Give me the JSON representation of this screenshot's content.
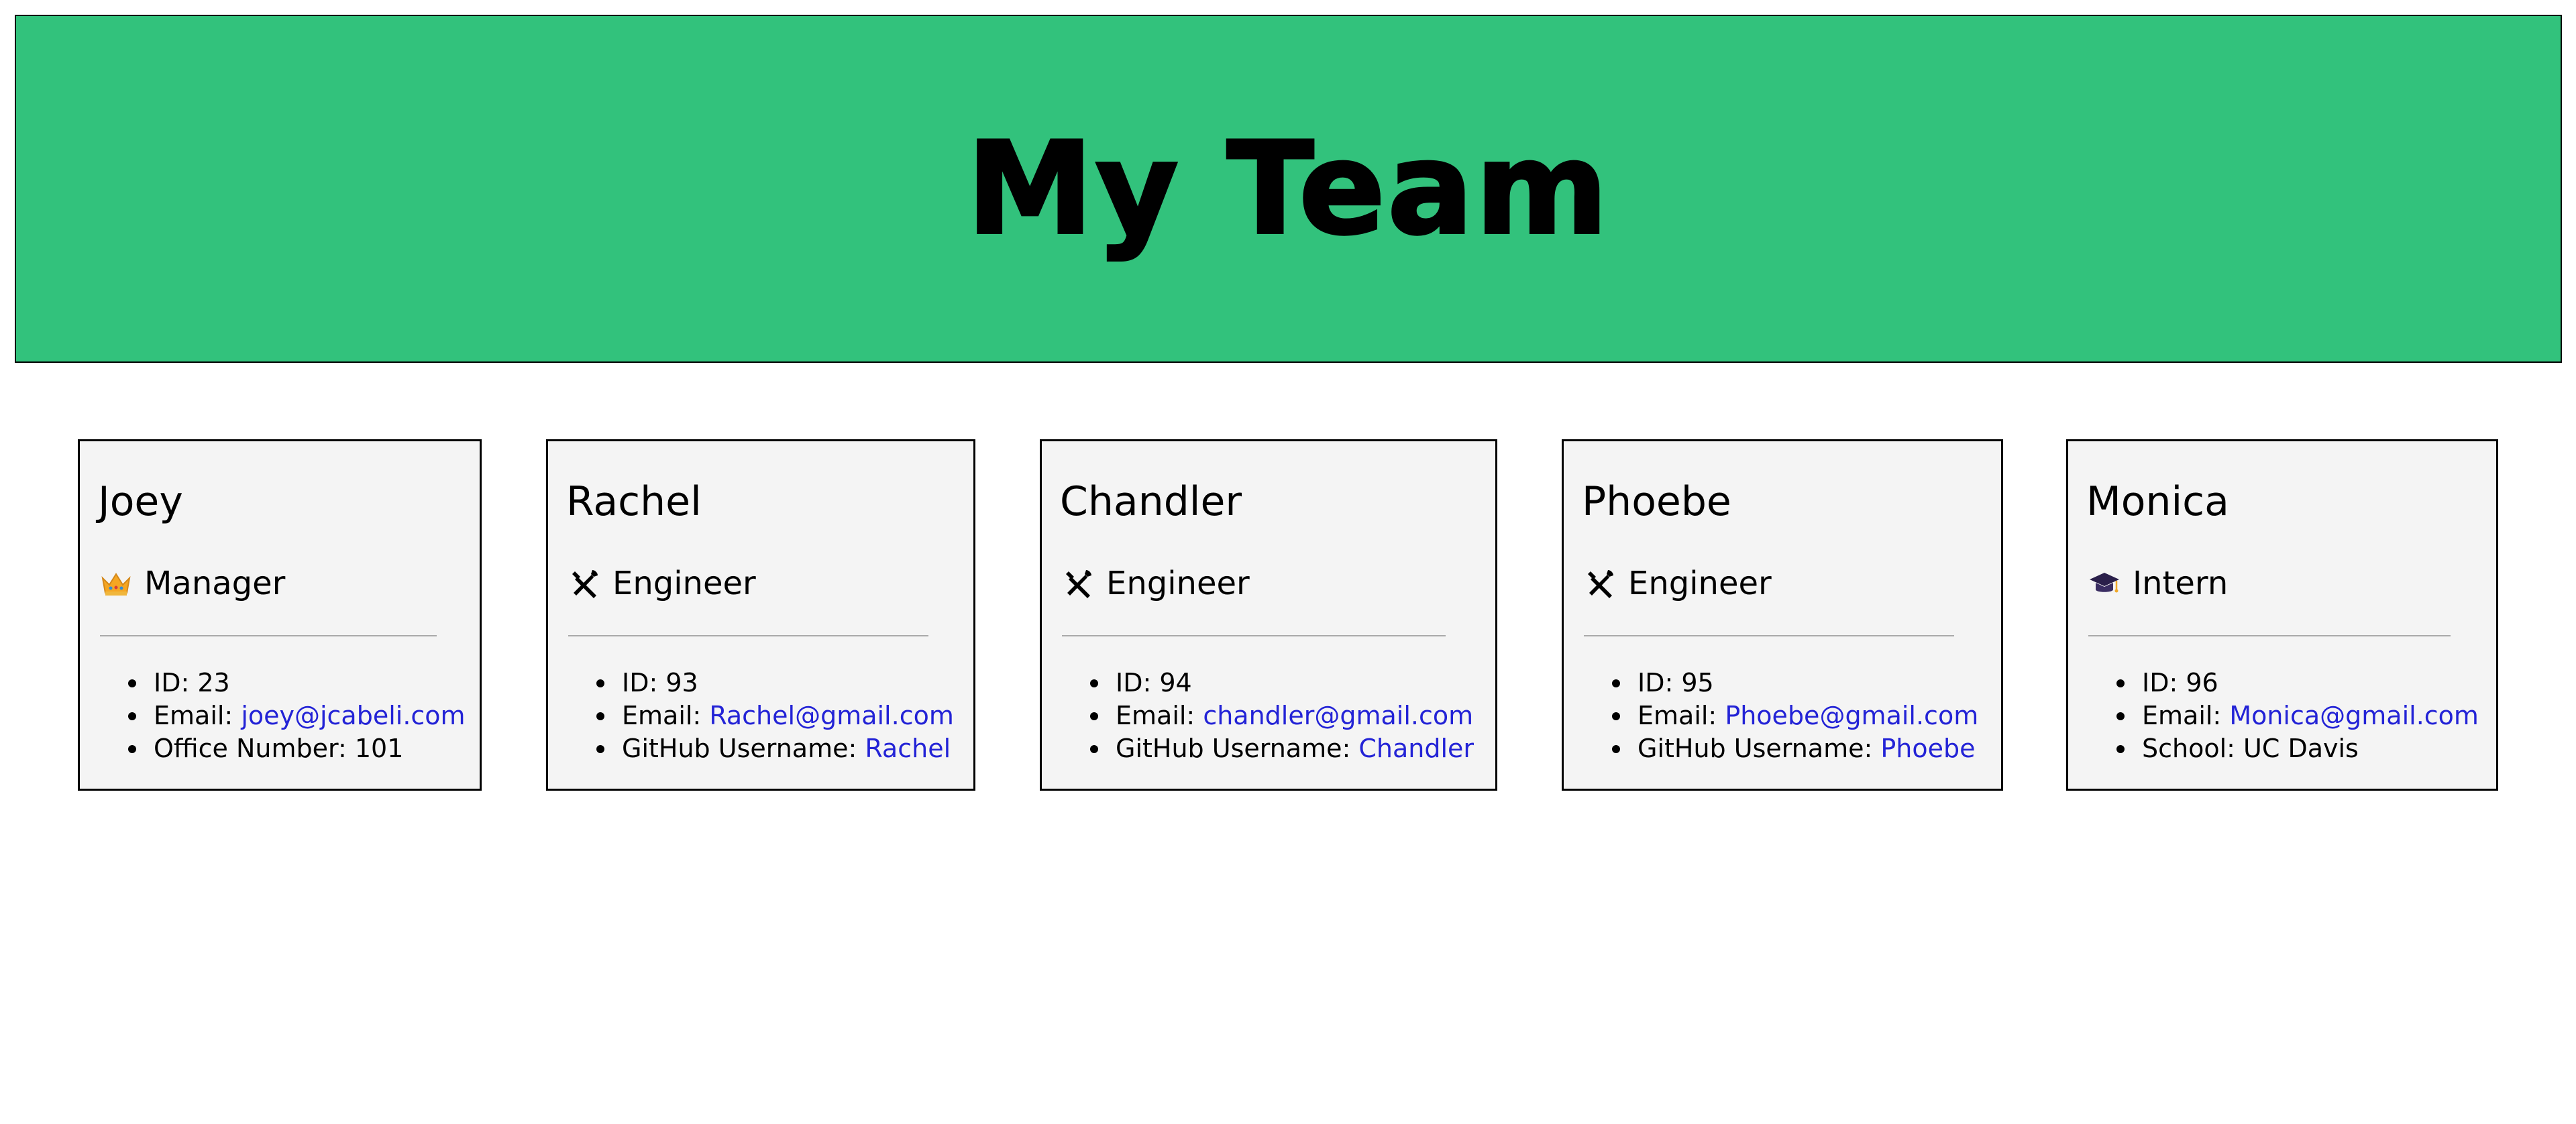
{
  "header": {
    "title": "My Team"
  },
  "colors": {
    "header_bg": "#32c27c",
    "card_bg": "#f4f4f4",
    "link": "#2323d6",
    "divider": "#a9a9a9"
  },
  "team": [
    {
      "name": "Joey",
      "role": "Manager",
      "role_icon": "crown-icon",
      "id_text": "ID: 23",
      "email_label": "Email: ",
      "email": "joey@jcabeli.com",
      "extra_label": "Office Number: 101",
      "extra_value": ""
    },
    {
      "name": "Rachel",
      "role": "Engineer",
      "role_icon": "tools-icon",
      "id_text": "ID: 93",
      "email_label": "Email: ",
      "email": "Rachel@gmail.com",
      "extra_label": "GitHub Username: ",
      "extra_value": "Rachel"
    },
    {
      "name": "Chandler",
      "role": "Engineer",
      "role_icon": "tools-icon",
      "id_text": "ID: 94",
      "email_label": "Email: ",
      "email": "chandler@gmail.com",
      "extra_label": "GitHub Username: ",
      "extra_value": "Chandler"
    },
    {
      "name": "Phoebe",
      "role": "Engineer",
      "role_icon": "tools-icon",
      "id_text": "ID: 95",
      "email_label": "Email: ",
      "email": "Phoebe@gmail.com",
      "extra_label": "GitHub Username: ",
      "extra_value": "Phoebe"
    },
    {
      "name": "Monica",
      "role": "Intern",
      "role_icon": "graduation-cap-icon",
      "id_text": "ID: 96",
      "email_label": "Email: ",
      "email": "Monica@gmail.com",
      "extra_label": "School: UC Davis",
      "extra_value": ""
    }
  ]
}
